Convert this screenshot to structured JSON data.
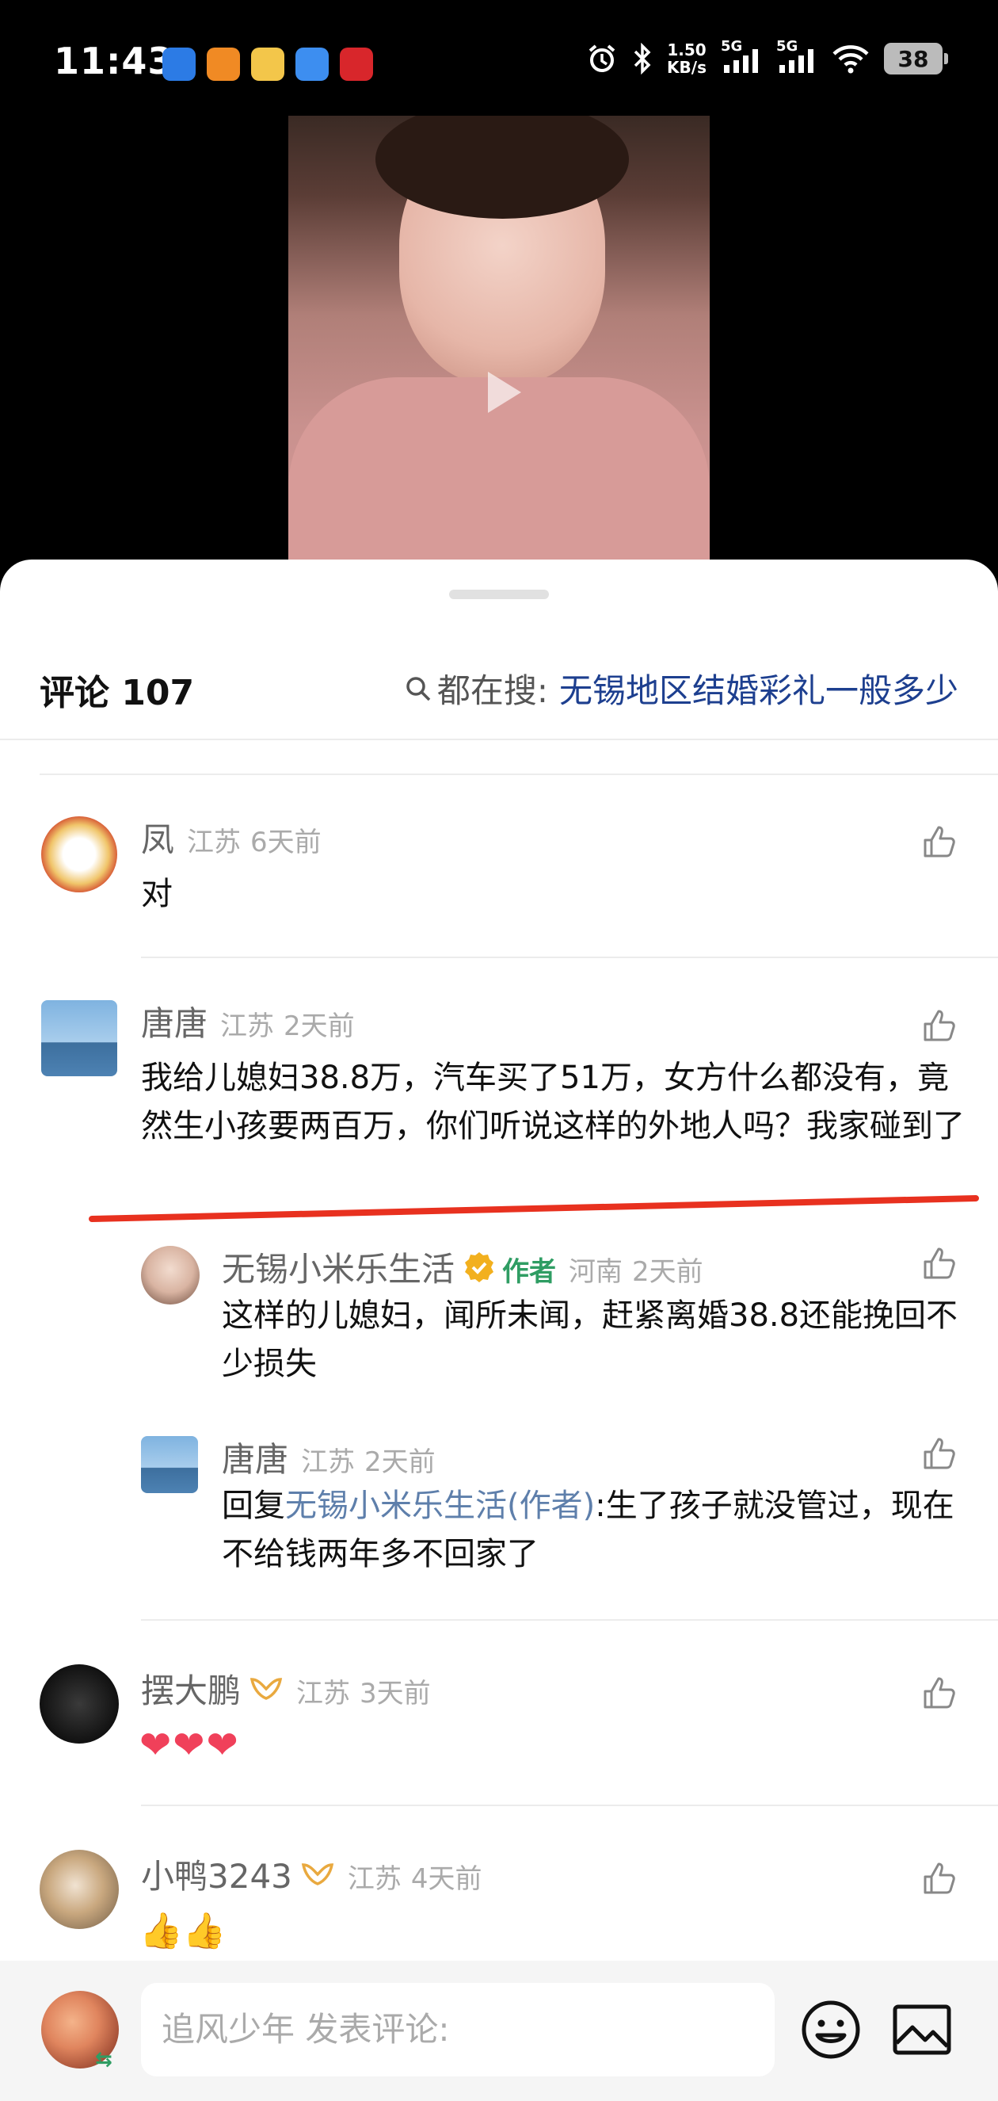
{
  "status_bar": {
    "time": "11:43",
    "net_speed_value": "1.50",
    "net_speed_unit": "KB/s",
    "sim1": "5G",
    "sim2": "5G",
    "battery": "38"
  },
  "video": {
    "icons": [
      "play-icon"
    ]
  },
  "comments_header": {
    "label": "评论 107",
    "search_label": "都在搜:",
    "search_term": "无锡地区结婚彩礼一般多少"
  },
  "comments": [
    {
      "user": "凤",
      "location": "江苏",
      "time": "6天前",
      "text": "对"
    },
    {
      "user": "唐唐",
      "location": "江苏",
      "time": "2天前",
      "text": "我给儿媳妇38.8万，汽车买了51万，女方什么都没有，竟然生小孩要两百万，你们听说这样的外地人吗？我家碰到了"
    },
    {
      "user": "无锡小米乐生活",
      "author_tag": "作者",
      "location": "河南",
      "time": "2天前",
      "text": "这样的儿媳妇，闻所未闻，赶紧离婚38.8还能挽回不少损失"
    },
    {
      "user": "唐唐",
      "location": "江苏",
      "time": "2天前",
      "reply_prefix": "回复",
      "reply_target": "无锡小米乐生活(作者)",
      "text": ":生了孩子就没管过，现在不给钱两年多不回家了"
    },
    {
      "user": "摆大鹏",
      "location": "江苏",
      "time": "3天前",
      "text_emoji": "❤❤❤"
    },
    {
      "user": "小鸭3243",
      "location": "江苏",
      "time": "4天前",
      "text_emoji": "👍👍"
    }
  ],
  "input_bar": {
    "placeholder": "追风少年 发表评论:",
    "icons": [
      "emoji-icon",
      "image-icon"
    ]
  },
  "colors": {
    "link_blue": "#1d3f8f",
    "author_green": "#2f9d63",
    "underline_red": "#e8311f"
  }
}
